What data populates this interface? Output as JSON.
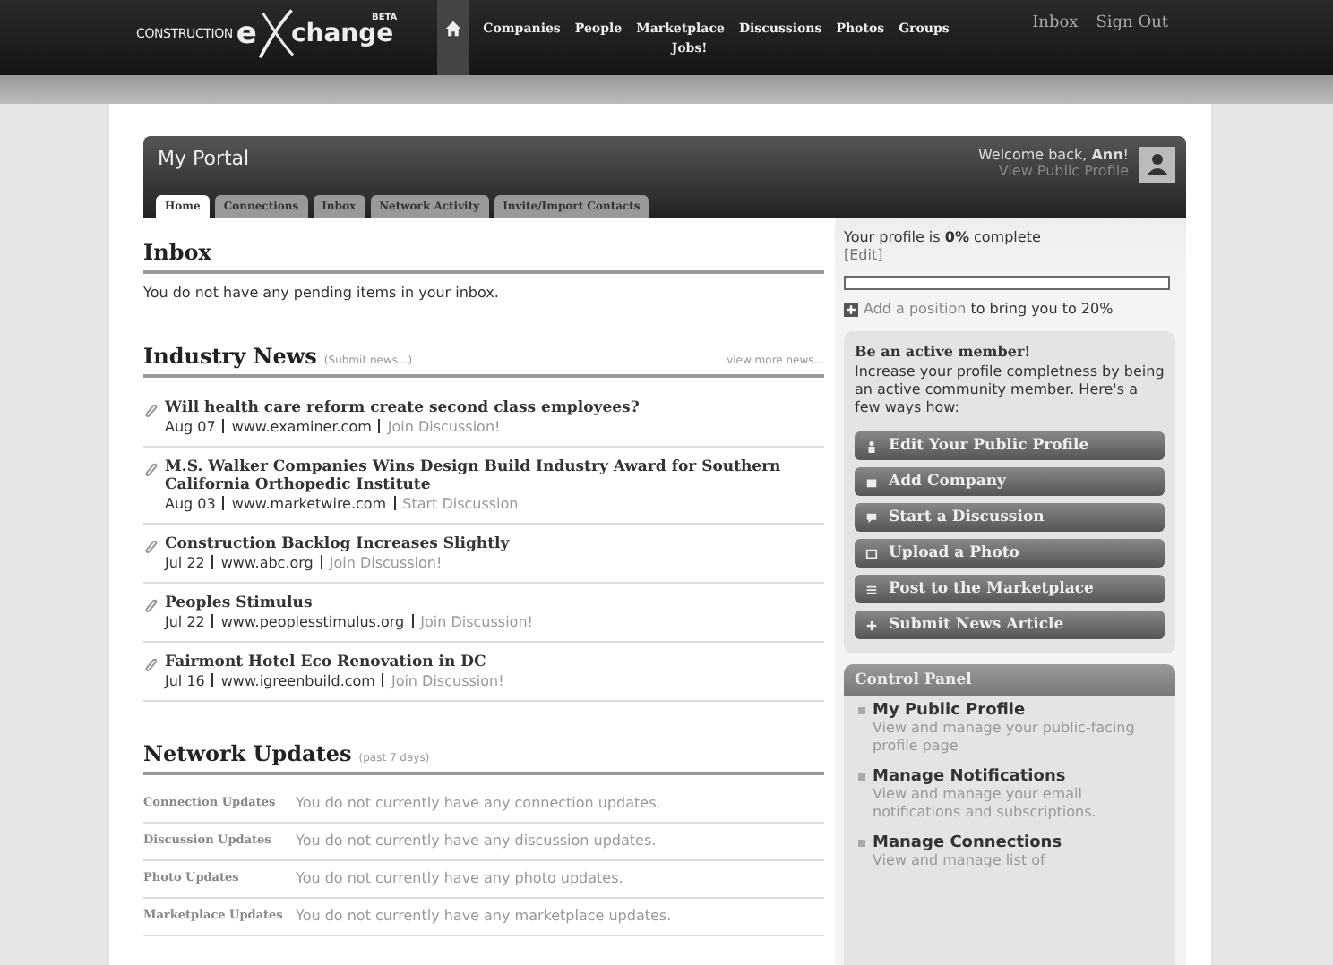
{
  "logo": {
    "prefix": "CONSTRUCTION",
    "e": "e",
    "rest": "change",
    "badge": "BETA"
  },
  "nav": [
    {
      "kind": "home",
      "selected": true
    },
    {
      "kind": "link",
      "label": "Companies",
      "selected": false
    },
    {
      "kind": "link",
      "label": "People",
      "selected": false
    },
    {
      "kind": "link",
      "label": "Marketplace",
      "selected": false,
      "sub": "Jobs!"
    },
    {
      "kind": "link",
      "label": "Discussions",
      "selected": false
    },
    {
      "kind": "link",
      "label": "Photos",
      "selected": false
    },
    {
      "kind": "link",
      "label": "Groups",
      "selected": false
    }
  ],
  "user_links": [
    "Inbox",
    "Sign Out"
  ],
  "portal": {
    "title": "My Portal",
    "welcome": "Welcome back, **Ann**!",
    "profile_link": "View Public Profile",
    "tabs": [
      {
        "label": "Home",
        "selected": true
      },
      {
        "label": "Connections",
        "selected": false
      },
      {
        "label": "Inbox",
        "selected": false
      },
      {
        "label": "Network Activity",
        "selected": false
      },
      {
        "label": "Invite/Import Contacts",
        "selected": false
      }
    ]
  },
  "inbox": {
    "title": "Inbox",
    "message": "You do not have any pending items in your inbox."
  },
  "news": {
    "title": "Industry News",
    "submit": "(Submit news...)",
    "more": "view more news...",
    "items": [
      {
        "title": "Will health care reform create second class employees?",
        "date": "Aug 07",
        "source": "www.examiner.com",
        "action": "Join Discussion!"
      },
      {
        "title": "M.S. Walker Companies Wins Design Build Industry Award for Southern California Orthopedic Institute",
        "date": "Aug 03",
        "source": "www.marketwire.com",
        "action": "Start Discussion"
      },
      {
        "title": "Construction Backlog Increases Slightly",
        "date": "Jul 22",
        "source": "www.abc.org",
        "action": "Join Discussion!"
      },
      {
        "title": "Peoples Stimulus",
        "date": "Jul 22",
        "source": "www.peoplesstimulus.org",
        "action": "Join Discussion!"
      },
      {
        "title": "Fairmont Hotel Eco Renovation in DC",
        "date": "Jul 16",
        "source": "www.igreenbuild.com",
        "action": "Join Discussion!"
      }
    ]
  },
  "updates": {
    "title": "Network Updates",
    "note": "(past 7 days)",
    "rows": [
      {
        "label": "Connection Updates",
        "text": "You do not currently have any connection updates."
      },
      {
        "label": "Discussion Updates",
        "text": "You do not currently have any discussion updates."
      },
      {
        "label": "Photo Updates",
        "text": "You do not currently have any photo updates."
      },
      {
        "label": "Marketplace Updates",
        "text": "You do not currently have any marketplace updates."
      }
    ]
  },
  "profile": {
    "status": "Your profile is **0%** complete",
    "edit": "[Edit]",
    "level": 0,
    "add_link": "Add a position",
    "add_rest": "to bring you to 20%"
  },
  "active": {
    "title": "Be an active member!",
    "text": "Increase your profile completness by being an active community member. Here's a few ways how:",
    "buttons": [
      {
        "kind": "person",
        "label": "Edit Your Public Profile"
      },
      {
        "kind": "building",
        "label": "Add Company"
      },
      {
        "kind": "chat",
        "label": "Start a Discussion"
      },
      {
        "kind": "photo",
        "label": "Upload a Photo"
      },
      {
        "kind": "list",
        "label": "Post to the Marketplace"
      },
      {
        "kind": "plus",
        "label": "Submit News Article"
      }
    ]
  },
  "control_panel": {
    "title": "Control Panel",
    "items": [
      {
        "title": "My Public Profile",
        "text": "View and manage your public-facing profile page"
      },
      {
        "title": "Manage Notifications",
        "text": "View and manage your email notifications and subscriptions."
      },
      {
        "title": "Manage Connections",
        "text": "View and manage list of"
      }
    ]
  }
}
